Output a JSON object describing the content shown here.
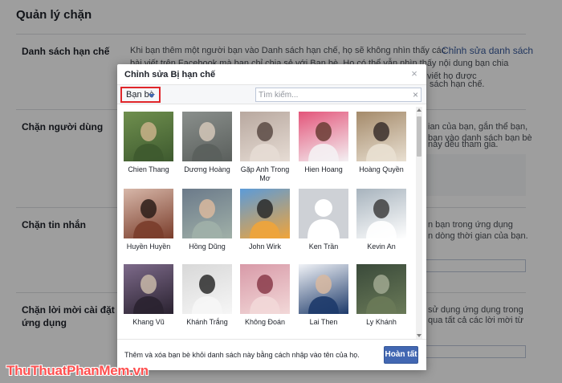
{
  "background": {
    "title": "Quản lý chặn",
    "sections": [
      {
        "label": "Danh sách hạn chế",
        "text_lines": [
          "Khi bạn thêm một người bạn vào Danh sách hạn chế, họ sẽ không nhìn thấy các",
          "bài viết trên Facebook mà bạn chỉ chia sẻ với Bạn bè. Họ có thể vẫn nhìn thấy nội dung bạn chia",
          "viết họ được",
          "sách hạn chế."
        ],
        "link": "Chỉnh sửa danh sách"
      },
      {
        "label": "Chặn người dùng",
        "text_lines": [
          "ian của bạn, gắn thể bạn,",
          "bạn vào danh sách bạn bè",
          "này đều tham gia."
        ]
      },
      {
        "label": "Chặn tin nhắn",
        "text_lines": [
          "n bạn trong ứng dụng",
          "n dòng thời gian của bạn."
        ]
      },
      {
        "label": "Chặn lời mời cài đặt ứng dụng",
        "text_lines": [
          "sử dụng ứng dụng trong",
          "qua tất cả các lời mời từ"
        ]
      }
    ]
  },
  "dialog": {
    "title": "Chỉnh sửa Bị hạn chế",
    "close_glyph": "×",
    "filter": {
      "selected": "Bạn bè"
    },
    "search": {
      "placeholder": "Tìm kiếm...",
      "value": "",
      "clear_glyph": "×"
    },
    "friends": [
      {
        "name": "Chien Thang"
      },
      {
        "name": "Dương Hoàng"
      },
      {
        "name": "Gặp Anh Trong Mơ"
      },
      {
        "name": "Hien Hoang"
      },
      {
        "name": "Hoàng Quyền"
      },
      {
        "name": "Huyền Huyền"
      },
      {
        "name": "Hồng Dũng"
      },
      {
        "name": "John Wirk"
      },
      {
        "name": "Ken Trần"
      },
      {
        "name": "Kevin An"
      },
      {
        "name": "Khang Vũ"
      },
      {
        "name": "Khánh Trắng"
      },
      {
        "name": "Không Đoán"
      },
      {
        "name": "Lai Then"
      },
      {
        "name": "Ly Khánh"
      }
    ],
    "footer_note": "Thêm và xóa bạn bè khỏi danh sách này bằng cách nhập vào tên của họ.",
    "done_label": "Hoàn tất"
  },
  "watermark": {
    "part1": "ThuThuat",
    "part2": "PhanMem",
    "part3": ".vn"
  }
}
